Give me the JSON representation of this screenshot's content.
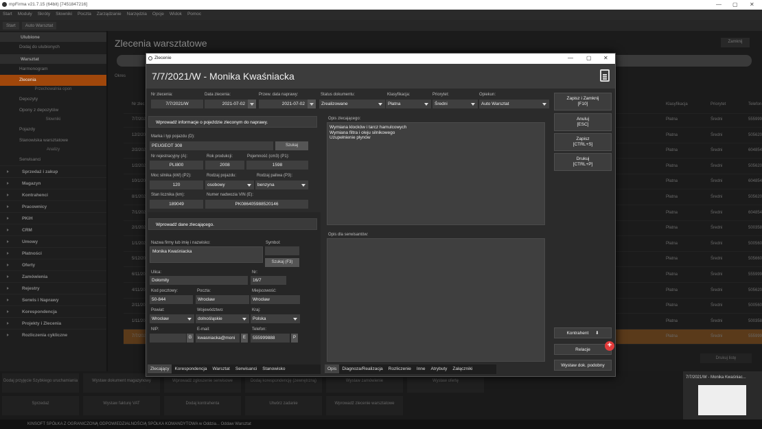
{
  "app": {
    "title": "mpFirma v21.7.15 (64bit) [7451847216]",
    "menu": [
      "Start",
      "Moduły",
      "Skróty",
      "Słowniki",
      "Poczta",
      "Zarządzanie",
      "Narzędzia",
      "Opcje",
      "Widok",
      "Pomoc"
    ],
    "tabs": [
      "Start",
      "Auto Warsztat"
    ],
    "status": "KINSOFT SPÓŁKA Z OGRANICZONĄ ODPOWIEDZIALNOŚCIĄ SPÓŁKA KOMANDYTOWA w Oddzia... Oddaw Warsztat"
  },
  "sidebar": {
    "items": [
      {
        "label": "Ulubione",
        "type": "head"
      },
      {
        "label": "Dodaj do ulubionych",
        "type": "item"
      },
      {
        "label": "Warsztat",
        "type": "head"
      },
      {
        "label": "Harmonogram",
        "type": "item"
      },
      {
        "label": "Zlecenia",
        "type": "active"
      },
      {
        "label": "Przechowalnia opon",
        "type": "sub"
      },
      {
        "label": "Depozyty",
        "type": "item"
      },
      {
        "label": "Opony z depozytów",
        "type": "item"
      },
      {
        "label": "Słowniki",
        "type": "sub"
      },
      {
        "label": "Pojazdy",
        "type": "item"
      },
      {
        "label": "Stanowiska warsztatowe",
        "type": "item"
      },
      {
        "label": "Analizy",
        "type": "sub"
      },
      {
        "label": "Serwisanci",
        "type": "item"
      }
    ],
    "categories": [
      "Sprzedaż i zakup",
      "Magazyn",
      "Kontrahenci",
      "Pracownicy",
      "PKiH",
      "CRM",
      "Umowy",
      "Płatności",
      "Oferty",
      "Zamówienia",
      "Rejestry",
      "Serwis i Naprawy",
      "Korespondencja",
      "Projekty i Zlecenia",
      "Rozliczenia cykliczne"
    ]
  },
  "background": {
    "page_title": "Zlecenia warsztatowe",
    "close_label": "Zamknij",
    "filter_label": "Okres",
    "columns": [
      "Nr zlec",
      "Klasyfikacja",
      "Priorytet",
      "Telefon"
    ],
    "rows": [
      [
        "7/7/2021",
        "Płatna",
        "Średni",
        "555999888"
      ],
      [
        "12/2/2021",
        "Płatna",
        "Średni",
        "505620510"
      ],
      [
        "2/2/2021",
        "Płatna",
        "Średni",
        "604854905"
      ],
      [
        "1/2/2021",
        "Płatna",
        "Średni",
        "505620510"
      ],
      [
        "10/1/2021",
        "Płatna",
        "Średni",
        "604854905"
      ],
      [
        "8/1/2021",
        "Płatna",
        "Średni",
        "505620510"
      ],
      [
        "7/1/2021",
        "Płatna",
        "Średni",
        "604854905"
      ],
      [
        "2/1/2021",
        "Płatna",
        "Średni",
        "500358624"
      ],
      [
        "1/1/2021",
        "Płatna",
        "Średni",
        "500560862"
      ],
      [
        "5/12/2020",
        "Płatna",
        "Średni",
        "505660986"
      ],
      [
        "6/11/2020",
        "Płatna",
        "Średni",
        "555999888"
      ],
      [
        "4/11/2020",
        "Płatna",
        "Średni",
        "505620510"
      ],
      [
        "2/11/2020",
        "Płatna",
        "Średni",
        "500560862"
      ],
      [
        "1/11/2020",
        "Płatna",
        "Średni",
        "500358624"
      ],
      [
        "7/7/2021",
        "Płatna",
        "Średni",
        "555999888"
      ]
    ],
    "actions": [
      "Dodaj przyjęcie Szybkiego uruchamiania",
      "Wystaw dokument magazynowy",
      "Wprowadź zgłoszenie serwisowe",
      "Dodaj korespondencję (zewnętrzną)",
      "Wystaw zamówienie",
      "Wystaw ofertę",
      "Sprzedaż",
      "Wystaw fakturę VAT",
      "Dodaj kontrahenta",
      "Utwórz zadanie",
      "Wprowadź zlecenie warsztatowe"
    ],
    "preview_title": "7/7/2021/W - Monika Kwaśniac...",
    "print_label": "Drukuj listę"
  },
  "dialog": {
    "window_title": "Zlecenie",
    "header": "7/7/2021/W - Monika Kwaśniacka",
    "order": {
      "nr_label": "Nr zlecenia:",
      "nr": "7/7/2021/W",
      "date_label": "Data zlecenia:",
      "date": "2021-07-02",
      "repair_label": "Przew. data naprawy:",
      "repair": "2021-07-02",
      "status_label": "Status dokumentu:",
      "status": "Zrealizowane",
      "class_label": "Klasyfikacja:",
      "class": "Płatna",
      "priority_label": "Priorytet:",
      "priority": "Średni",
      "keeper_label": "Opiekun:",
      "keeper": "Auto Warsztat"
    },
    "vehicle": {
      "section": "Wprowadź informacje o pojeździe zleconym do naprawy.",
      "make_label": "Marka i typ pojazdu (D):",
      "make": "PEUGEOT 308",
      "search": "Szukaj",
      "reg_label": "Nr rejestracyjny (A):",
      "reg": "PLI800",
      "year_label": "Rok produkcji:",
      "year": "2008",
      "cap_label": "Pojemność (cm3) (P1):",
      "cap": "1598",
      "power_label": "Moc silnika (kW) (P2):",
      "power": "120",
      "type_label": "Rodzaj pojazdu:",
      "type": "osobowy",
      "fuel_label": "Rodzaj paliwa (P3):",
      "fuel": "benzyna",
      "odo_label": "Stan licznika (km):",
      "odo": "189049",
      "vin_label": "Numer nadwozia VIN (E):",
      "vin": "PK086405988520146"
    },
    "client": {
      "section": "Wprowadź dane zlecającego.",
      "name_label": "Nazwa firmy lub imię i nazwisko:",
      "name": "Monika Kwaśniacka",
      "symbol_label": "Symbol:",
      "search": "Szukaj (F3)",
      "street_label": "Ulica:",
      "street": "Dołomity",
      "no_label": "Nr:",
      "no": "16/7",
      "zip_label": "Kod pocztowy:",
      "zip": "50-844",
      "post_label": "Poczta:",
      "post": "Wrocław",
      "city_label": "Miejscowość:",
      "city": "Wrocław",
      "county_label": "Powiat:",
      "county": "Wrocław",
      "voiv_label": "Województwo:",
      "voiv": "dolnośląskie",
      "country_label": "Kraj:",
      "country": "Polska",
      "nip_label": "NIP:",
      "email_label": "E-mail:",
      "email": "kwasniacka@moni",
      "phone_label": "Telefon:",
      "phone": "555999888"
    },
    "desc": {
      "client_label": "Opis zlecającego:",
      "client_lines": [
        "Wymiana klocków i tarcz hamulcowych",
        "Wymiana filtra i oleju silnikowego",
        "Uzupełnienie płynów"
      ],
      "service_label": "Opis dla serwisantów:"
    },
    "left_tabs": [
      "Zlecający",
      "Korespondencja",
      "Warsztat",
      "Serwisanci",
      "Stanowisko"
    ],
    "right_tabs": [
      "Opis",
      "Diagnoza/Realizacja",
      "Rozliczenie",
      "Inne",
      "Atrybuty",
      "Załączniki"
    ],
    "buttons": {
      "save_close": "Zapisz i Zamknij",
      "save_close_key": "[F10]",
      "cancel": "Anuluj",
      "cancel_key": "[ESC]",
      "save": "Zapisz",
      "save_key": "[CTRL+S]",
      "print": "Drukuj",
      "print_key": "[CTRL+P]",
      "contractor": "Kontrahent",
      "relations": "Relacje",
      "similar": "Wystaw dok. podobny"
    },
    "side_letters": {
      "g": "G",
      "e": "E",
      "p": "P"
    }
  }
}
